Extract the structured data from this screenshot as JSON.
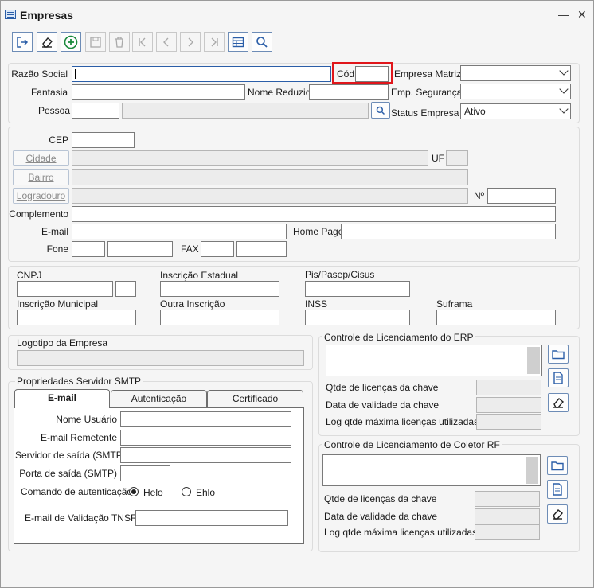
{
  "window": {
    "title": "Empresas",
    "minimize": "—",
    "close": "✕"
  },
  "toolbar": [
    {
      "name": "exit-icon"
    },
    {
      "name": "eraser-icon"
    },
    {
      "name": "add-icon"
    },
    {
      "name": "save-icon"
    },
    {
      "name": "delete-icon"
    },
    {
      "name": "first-icon"
    },
    {
      "name": "prev-icon"
    },
    {
      "name": "next-icon"
    },
    {
      "name": "last-icon"
    },
    {
      "name": "grid-icon"
    },
    {
      "name": "search-icon"
    }
  ],
  "main": {
    "razao_social": "Razão Social",
    "cod": "Cód",
    "empresa_matriz": "Empresa Matriz",
    "fantasia": "Fantasia",
    "nome_reduzido": "Nome Reduzido",
    "emp_seguranca": "Emp. Segurança",
    "pessoa": "Pessoa",
    "status_empresa": "Status Empresa",
    "status_value": "Ativo"
  },
  "address": {
    "cep": "CEP",
    "cidade": "Cidade",
    "uf": "UF",
    "bairro": "Bairro",
    "logradouro": "Logradouro",
    "numero": "Nº",
    "complemento": "Complemento",
    "email": "E-mail",
    "home_page": "Home Page",
    "fone": "Fone",
    "fax": "FAX"
  },
  "docs": {
    "cnpj": "CNPJ",
    "insc_estadual": "Inscrição Estadual",
    "pis": "Pis/Pasep/Cisus",
    "insc_municipal": "Inscrição Municipal",
    "outra_insc": "Outra Inscrição",
    "inss": "INSS",
    "suframa": "Suframa"
  },
  "logo": {
    "label": "Logotipo da Empresa"
  },
  "smtp": {
    "group": "Propriedades Servidor SMTP",
    "tabs": [
      "E-mail",
      "Autenticação",
      "Certificado"
    ],
    "nome_usuario": "Nome Usuário",
    "email_remetente": "E-mail Remetente",
    "servidor_saida": "Servidor de saída (SMTP)",
    "porta_saida": "Porta de saída (SMTP)",
    "comando_auth": "Comando de autenticação",
    "helo": "Helo",
    "ehlo": "Ehlo",
    "email_validacao": "E-mail de Validação TNSRV"
  },
  "erp": {
    "group": "Controle de Licenciamento do ERP",
    "qtde": "Qtde de licenças da chave",
    "validade": "Data de validade da chave",
    "log": "Log qtde máxima licenças utilizadas"
  },
  "coletor": {
    "group": "Controle de Licenciamento de Coletor RF",
    "qtde": "Qtde de licenças da chave",
    "validade": "Data de validade da chave",
    "log": "Log qtde máxima licenças utilizadas"
  },
  "colors": {
    "accent": "#2b5ea8",
    "highlight": "#e0161b"
  }
}
